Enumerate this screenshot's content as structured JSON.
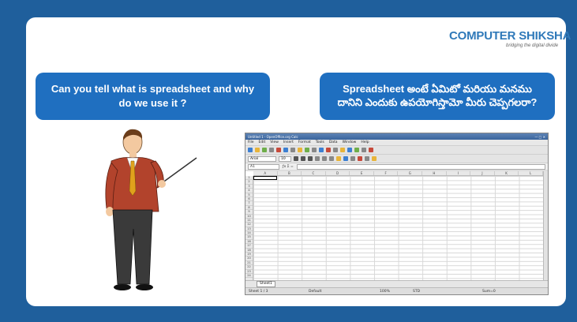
{
  "logo": {
    "title": "COMPUTER SHIKSHA",
    "tagline": "bridging the digital divide"
  },
  "question_en": "Can you tell what is spreadsheet and why do we use it ?",
  "question_te": "Spreadsheet అంటే ఏమిటో మరియు మనము దానిని ఎందుకు ఉపయోగిస్తామో మీరు చెప్పగలరా?",
  "spreadsheet": {
    "window_title": "Untitled 1 - OpenOffice.org Calc",
    "menu": [
      "File",
      "Edit",
      "View",
      "Insert",
      "Format",
      "Tools",
      "Data",
      "Window",
      "Help"
    ],
    "font_name": "Arial",
    "font_size": "10",
    "cell_ref": "A1",
    "columns": [
      "A",
      "B",
      "C",
      "D",
      "E",
      "F",
      "G",
      "H",
      "I",
      "J",
      "K",
      "L"
    ],
    "sheet_tab": "Sheet1",
    "status_sheet": "Sheet 1 / 3",
    "status_style": "Default",
    "status_zoom": "100%",
    "status_mode": "STD",
    "status_sum": "Sum=0"
  },
  "colors": {
    "background": "#1f5f9c",
    "bubble": "#1f6fc0",
    "logo": "#2f79b9"
  }
}
